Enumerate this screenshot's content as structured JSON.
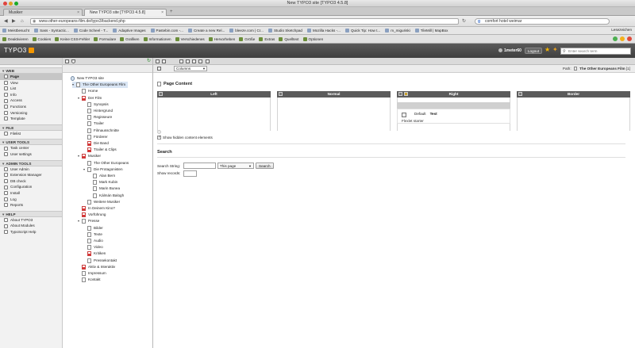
{
  "browser": {
    "window_title": "New TYPO3 site [TYPO3 4.5.8]",
    "tabs": [
      {
        "label": "Musiker",
        "active": false
      },
      {
        "label": "New TYPO3 site [TYPO3 4.5.8]",
        "active": true
      }
    ],
    "url": "www.other-europeans-film.de/typo3/backend.php",
    "search_value": "comfort hotel weimar",
    "bookmarks": [
      "Meistbesucht",
      "Sass - Syntactic...",
      "Code Scheel - T...",
      "Adaptive Images",
      "Pastebin.com -...",
      "Create a new Rel...",
      "bleeze.com | Cr...",
      "Studio Sketchpad",
      "Mozilla Hacks -...",
      "Quick Tip: How t...",
      "m_miguriski",
      "TileMill | MapBox"
    ],
    "bookmarks_right": "Lesezeichen",
    "addons": [
      "Deaktivieren",
      "Cookies",
      "Keine CSS-Fehler",
      "Formulare",
      "Grafiken",
      "Informationen",
      "Verschiedenes",
      "Hervorheben",
      "Größe",
      "Extras",
      "Quelltext",
      "Optionen"
    ]
  },
  "typo3": {
    "logo_text": "TYPO3",
    "username": "1meter60",
    "logout_label": "Logout",
    "search_placeholder": "Enter search term"
  },
  "modules": [
    {
      "group": "WEB",
      "items": [
        {
          "label": "Page",
          "active": true
        },
        {
          "label": "View",
          "active": false
        },
        {
          "label": "List",
          "active": false
        },
        {
          "label": "Info",
          "active": false
        },
        {
          "label": "Access",
          "active": false
        },
        {
          "label": "Functions",
          "active": false
        },
        {
          "label": "Versioning",
          "active": false
        },
        {
          "label": "Template",
          "active": false
        }
      ]
    },
    {
      "group": "FILE",
      "items": [
        {
          "label": "Filelist",
          "active": false
        }
      ]
    },
    {
      "group": "USER TOOLS",
      "items": [
        {
          "label": "Task center",
          "active": false
        },
        {
          "label": "User settings",
          "active": false
        }
      ]
    },
    {
      "group": "ADMIN TOOLS",
      "items": [
        {
          "label": "User Admin",
          "active": false
        },
        {
          "label": "Extension Manager",
          "active": false
        },
        {
          "label": "DB check",
          "active": false
        },
        {
          "label": "Configuration",
          "active": false
        },
        {
          "label": "Install",
          "active": false
        },
        {
          "label": "Log",
          "active": false
        },
        {
          "label": "Reports",
          "active": false
        }
      ]
    },
    {
      "group": "HELP",
      "items": [
        {
          "label": "About TYPO3",
          "active": false
        },
        {
          "label": "About Modules",
          "active": false
        },
        {
          "label": "TypoScript Help",
          "active": false
        }
      ]
    }
  ],
  "tree": [
    {
      "label": "New TYPO3 site",
      "level": 0,
      "icon": "globe"
    },
    {
      "label": "The Other Europeans Film",
      "level": 1,
      "icon": "page",
      "selected": true,
      "expanded": true
    },
    {
      "label": "Home",
      "level": 2,
      "icon": "page"
    },
    {
      "label": "Der Film",
      "level": 2,
      "icon": "hidden",
      "expanded": true
    },
    {
      "label": "Synopsis",
      "level": 3,
      "icon": "page"
    },
    {
      "label": "Hintergrund",
      "level": 3,
      "icon": "page"
    },
    {
      "label": "Regisseure",
      "level": 3,
      "icon": "page"
    },
    {
      "label": "Trailer",
      "level": 3,
      "icon": "page"
    },
    {
      "label": "Filmausschnitte",
      "level": 3,
      "icon": "page"
    },
    {
      "label": "Förderer",
      "level": 3,
      "icon": "page"
    },
    {
      "label": "Die Band",
      "level": 3,
      "icon": "hidden"
    },
    {
      "label": "Trailer & Clips",
      "level": 3,
      "icon": "hidden"
    },
    {
      "label": "Musiker",
      "level": 2,
      "icon": "hidden",
      "expanded": true
    },
    {
      "label": "The Other Europeans",
      "level": 3,
      "icon": "page"
    },
    {
      "label": "Die Protagonisten",
      "level": 3,
      "icon": "page",
      "expanded": true
    },
    {
      "label": "Alan Bern",
      "level": 4,
      "icon": "page"
    },
    {
      "label": "Mark Kubin",
      "level": 4,
      "icon": "page"
    },
    {
      "label": "Marin Bunea",
      "level": 4,
      "icon": "page"
    },
    {
      "label": "Kálmán Balogh",
      "level": 4,
      "icon": "page"
    },
    {
      "label": "Weitere Musiker",
      "level": 3,
      "icon": "page"
    },
    {
      "label": "In Deinem Kino?",
      "level": 2,
      "icon": "hidden"
    },
    {
      "label": "Vorführung",
      "level": 2,
      "icon": "hidden"
    },
    {
      "label": "Presse",
      "level": 2,
      "icon": "page",
      "expanded": true
    },
    {
      "label": "Bilder",
      "level": 3,
      "icon": "page"
    },
    {
      "label": "Texte",
      "level": 3,
      "icon": "page"
    },
    {
      "label": "Audio",
      "level": 3,
      "icon": "page"
    },
    {
      "label": "Video",
      "level": 3,
      "icon": "page"
    },
    {
      "label": "Kritiken",
      "level": 3,
      "icon": "hidden"
    },
    {
      "label": "Pressekontakt",
      "level": 3,
      "icon": "page"
    },
    {
      "label": "Aktiv & Interaktiv",
      "level": 2,
      "icon": "hidden"
    },
    {
      "label": "Impressum",
      "level": 2,
      "icon": "page"
    },
    {
      "label": "Kontakt",
      "level": 2,
      "icon": "page"
    }
  ],
  "content": {
    "view_select": "Columns",
    "path_label": "Path:",
    "path_value": "The Other Europeans Film",
    "path_id": "[1]",
    "section_title": "Page Content",
    "columns": [
      "Left",
      "Normal",
      "Right",
      "Border"
    ],
    "element": {
      "type_label": "Default",
      "title": "Test",
      "subtitle": "Flexlet starter"
    },
    "show_hidden_label": "Show hidden content elements",
    "search_title": "Search",
    "search_string_label": "Search String:",
    "search_scope": "This page",
    "search_button": "Search",
    "show_records_label": "Show records:"
  }
}
